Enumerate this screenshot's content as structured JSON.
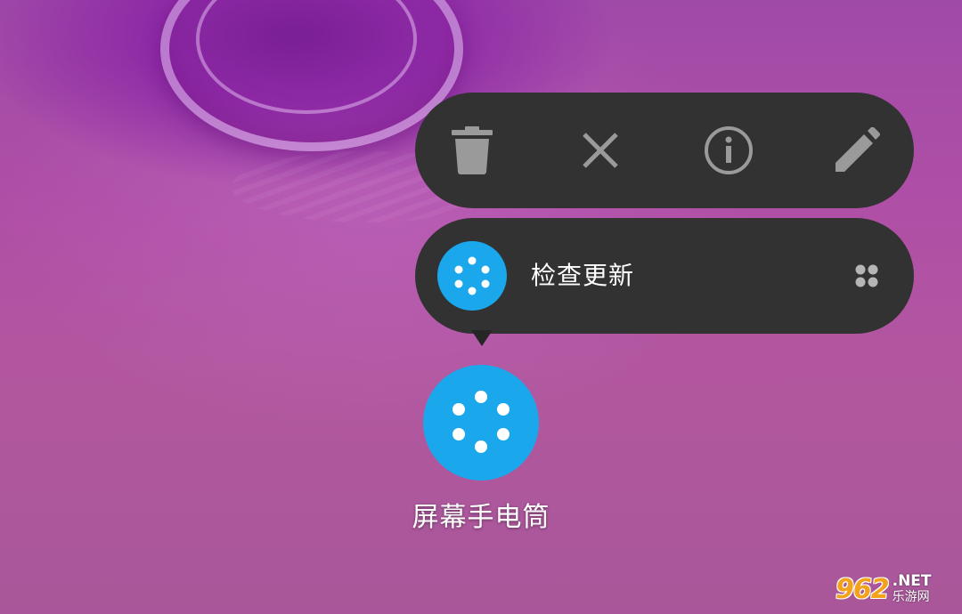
{
  "popup": {
    "actions": [
      {
        "icon": "trash-icon",
        "name": "remove"
      },
      {
        "icon": "close-icon",
        "name": "cancel"
      },
      {
        "icon": "info-icon",
        "name": "app-info"
      },
      {
        "icon": "pencil-icon",
        "name": "edit"
      }
    ],
    "shortcut": {
      "label": "检查更新",
      "icon": "dots-ring-icon",
      "handle_icon": "drag-handle-icon"
    }
  },
  "app": {
    "label": "屏幕手电筒",
    "icon": "dots-ring-icon"
  },
  "watermark": {
    "number": "962",
    "suffix": ".NET",
    "text": "乐游网"
  },
  "colors": {
    "panel": "#323232",
    "icon_gray": "#9a9a9a",
    "app_blue": "#1aa7ec",
    "watermark_orange": "#f3a21c"
  }
}
